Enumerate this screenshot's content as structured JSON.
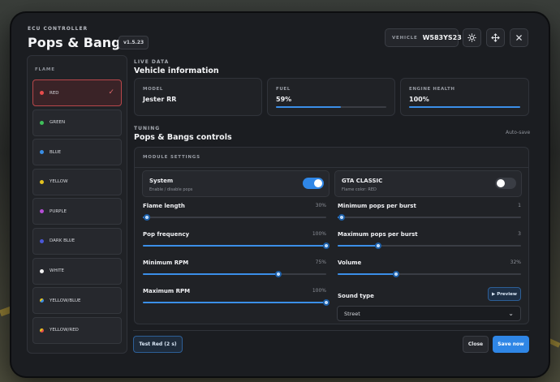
{
  "header": {
    "subtitle": "ECU CONTROLLER",
    "title": "Pops & Bangs",
    "version": "v1.5.23",
    "vehicle_label": "VEHICLE",
    "vehicle_plate": "W583YS23",
    "icons": [
      "sun-icon",
      "move-icon",
      "close-icon"
    ]
  },
  "flame": {
    "title": "FLAME",
    "selected": "RED",
    "items": [
      {
        "label": "RED",
        "color": "#e74c4c"
      },
      {
        "label": "GREEN",
        "color": "#3fbf5a"
      },
      {
        "label": "BLUE",
        "color": "#3a8ee6"
      },
      {
        "label": "YELLOW",
        "color": "#e3c21f"
      },
      {
        "label": "PURPLE",
        "color": "#b54ed6"
      },
      {
        "label": "DARK BLUE",
        "color": "#4a58d8"
      },
      {
        "label": "WHITE",
        "color": "#f2f2f2"
      },
      {
        "label": "YELLOW/BLUE",
        "color": "#e3c21f",
        "color2": "#3a8ee6"
      },
      {
        "label": "YELLOW/RED",
        "color": "#e3c21f",
        "color2": "#e74c4c"
      }
    ]
  },
  "live": {
    "subtitle": "LIVE DATA",
    "title": "Vehicle information",
    "model_label": "MODEL",
    "model_value": "Jester RR",
    "fuel_label": "FUEL",
    "fuel_value": "59%",
    "fuel_fraction": 0.59,
    "health_label": "ENGINE HEALTH",
    "health_value": "100%",
    "health_fraction": 1.0
  },
  "tuning": {
    "subtitle": "TUNING",
    "title": "Pops & Bangs controls",
    "autosave": "Auto-save",
    "module_title": "MODULE SETTINGS",
    "system": {
      "title": "System",
      "sub": "Enable / disable pops",
      "on": true
    },
    "gta_classic": {
      "title": "GTA CLASSIC",
      "sub": "Flame color: RED",
      "on": false
    },
    "sliders": [
      {
        "label": "Flame length",
        "value": "30%",
        "fraction": 0.02
      },
      {
        "label": "Pop frequency",
        "value": "100%",
        "fraction": 1.0
      },
      {
        "label": "Minimum RPM",
        "value": "75%",
        "fraction": 0.74
      },
      {
        "label": "Maximum RPM",
        "value": "100%",
        "fraction": 1.0
      },
      {
        "label": "Minimum pops per burst",
        "value": "1",
        "fraction": 0.02
      },
      {
        "label": "Maximum pops per burst",
        "value": "3",
        "fraction": 0.22
      },
      {
        "label": "Volume",
        "value": "32%",
        "fraction": 0.32
      }
    ],
    "sound_type_label": "Sound type",
    "preview_label": "▶ Preview",
    "sound_type_value": "Street"
  },
  "footer": {
    "test_label": "Test Red (2 s)",
    "close_label": "Close",
    "save_label": "Save now",
    "accent": "#2f86e6"
  }
}
